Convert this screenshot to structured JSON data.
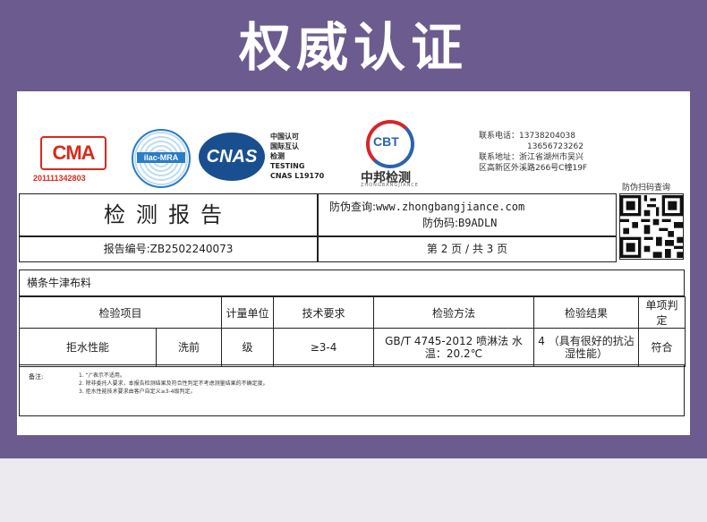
{
  "banner": {
    "title": "权威认证"
  },
  "logos": {
    "cma_mark": "CMA",
    "cma_number": "201111342803",
    "ilac_mark": "ilac-MRA",
    "cnas_mark": "CNAS",
    "mra_lines": [
      "中国认可",
      "国际互认",
      "检测",
      "TESTING",
      "CNAS L19170"
    ],
    "cbt_mark": "CBT",
    "cbt_name": "中邦检测",
    "cbt_en": "ZHONGBANGJIANCE"
  },
  "contact": {
    "lines": [
      "联系电话：13738204038",
      "13656723262",
      "联系地址：浙江省湖州市吴兴",
      "区高新区外溪路266号C幢19F"
    ]
  },
  "qr": {
    "label": "防伪扫码查询"
  },
  "report": {
    "title": "检测报告",
    "number_label": "报告编号:",
    "number": "ZB2502240073",
    "anti_query_label": "防伪查询:",
    "anti_query_url": "www.zhongbangjiance.com",
    "anti_code_label": "防伪码:",
    "anti_code": "B9ADLN",
    "page_info": "第 2 页 / 共 3 页"
  },
  "sample_name": "横条牛津布料",
  "table": {
    "headers": [
      "检验项目",
      "计量单位",
      "技术要求",
      "检验方法",
      "检验结果",
      "单项判定"
    ],
    "rows": [
      {
        "item": "拒水性能",
        "condition": "洗前",
        "unit": "级",
        "requirement": "≥3-4",
        "method": "GB/T 4745-2012 喷淋法 水温：20.2℃",
        "result": "4 （具有很好的抗沾湿性能）",
        "verdict": "符合"
      }
    ]
  },
  "notes": {
    "label": "备注:",
    "lines": [
      "1. “/”表示不适用。",
      "2. 除非委托人要求，本报告检测结果及符合性判定不考虑测量结果的不确定度。",
      "3. 拒水性能技术要求由客户自定义≥3-4级判定。"
    ]
  },
  "colors": {
    "banner": "#6c5b8e",
    "cma_red": "#d92a1c",
    "cnas_blue": "#1a4f8f",
    "cbt_blue": "#2a63b0"
  }
}
